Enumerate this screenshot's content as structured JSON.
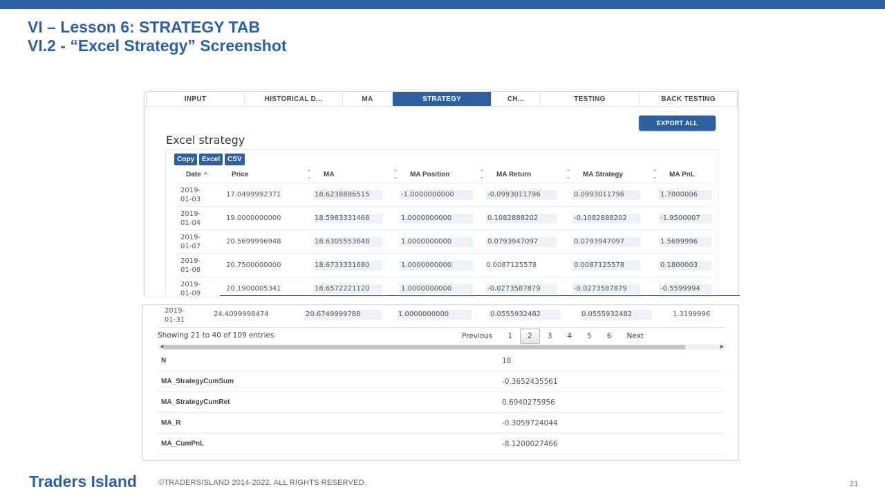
{
  "slide": {
    "title_line1": "VI – Lesson 6: STRATEGY TAB",
    "title_line2": "VI.2 - “Excel Strategy” Screenshot",
    "brand": "Traders Island",
    "copyright": "©TRADERSISLAND 2014-2022. ALL RIGHTS RESERVED.",
    "page_number": "21",
    "accent_color": "#2e5f9f"
  },
  "tabs": [
    {
      "label": "INPUT",
      "active": false
    },
    {
      "label": "HISTORICAL D...",
      "active": false
    },
    {
      "label": "MA",
      "active": false
    },
    {
      "label": "STRATEGY",
      "active": true
    },
    {
      "label": "CH...",
      "active": false
    },
    {
      "label": "TESTING",
      "active": false
    },
    {
      "label": "BACK TESTING",
      "active": false
    }
  ],
  "export_button": "EXPORT ALL",
  "section_heading": "Excel strategy",
  "dt_buttons": [
    "Copy",
    "Excel",
    "CSV"
  ],
  "table": {
    "columns": [
      "Date",
      "Price",
      "MA",
      "MA Position",
      "MA Return",
      "MA Strategy",
      "MA PnL"
    ],
    "sort_indicator_date": "^",
    "sort_icon": "sort-icon",
    "rows": [
      {
        "date1": "2019-",
        "date2": "01-03",
        "price": "17.0499992371",
        "ma": "18.6238886515",
        "pos": "-1.0000000000",
        "ret": "-0.0993011796",
        "strat": "0.0993011796",
        "pnl": "1.7800006"
      },
      {
        "date1": "2019-",
        "date2": "01-04",
        "price": "19.0000000000",
        "ma": "18.5983331468",
        "pos": "1.0000000000",
        "ret": "0.1082888202",
        "strat": "-0.1082888202",
        "pnl": "-1.9500007"
      },
      {
        "date1": "2019-",
        "date2": "01-07",
        "price": "20.5699996948",
        "ma": "18.6305553648",
        "pos": "1.0000000000",
        "ret": "0.0793947097",
        "strat": "0.0793947097",
        "pnl": "1.5699996"
      },
      {
        "date1": "2019-",
        "date2": "01-08",
        "price": "20.7500000000",
        "ma": "18.6733331680",
        "pos": "1.0000000000",
        "ret": "0.0087125578",
        "strat": "0.0087125578",
        "pnl": "0.1800003"
      },
      {
        "date1": "2019-",
        "date2": "01-09",
        "price": "20.1900005341",
        "ma": "18.6572221120",
        "pos": "1.0000000000",
        "ret": "-0.0273587879",
        "strat": "-0.0273587879",
        "pnl": "-0.5599994"
      }
    ],
    "last_row": {
      "date1": "2019-",
      "date2": "01-31",
      "price": "24.4099998474",
      "ma": "20.6749999788",
      "pos": "1.0000000000",
      "ret": "0.0555932482",
      "strat": "0.0555932482",
      "pnl": "1.3199996"
    }
  },
  "pagination": {
    "info": "Showing 21 to 40 of 109 entries",
    "previous": "Previous",
    "pages": [
      "1",
      "2",
      "3",
      "4",
      "5",
      "6"
    ],
    "current": "2",
    "next": "Next"
  },
  "stats": [
    {
      "label": "N",
      "value": "18"
    },
    {
      "label": "MA_StrategyCumSum",
      "value": "-0.3652435561"
    },
    {
      "label": "MA_StrategyCumRet",
      "value": "0.6940275956"
    },
    {
      "label": "MA_R",
      "value": "-0.3059724044"
    },
    {
      "label": "MA_CumPnL",
      "value": "-8.1200027466"
    }
  ]
}
